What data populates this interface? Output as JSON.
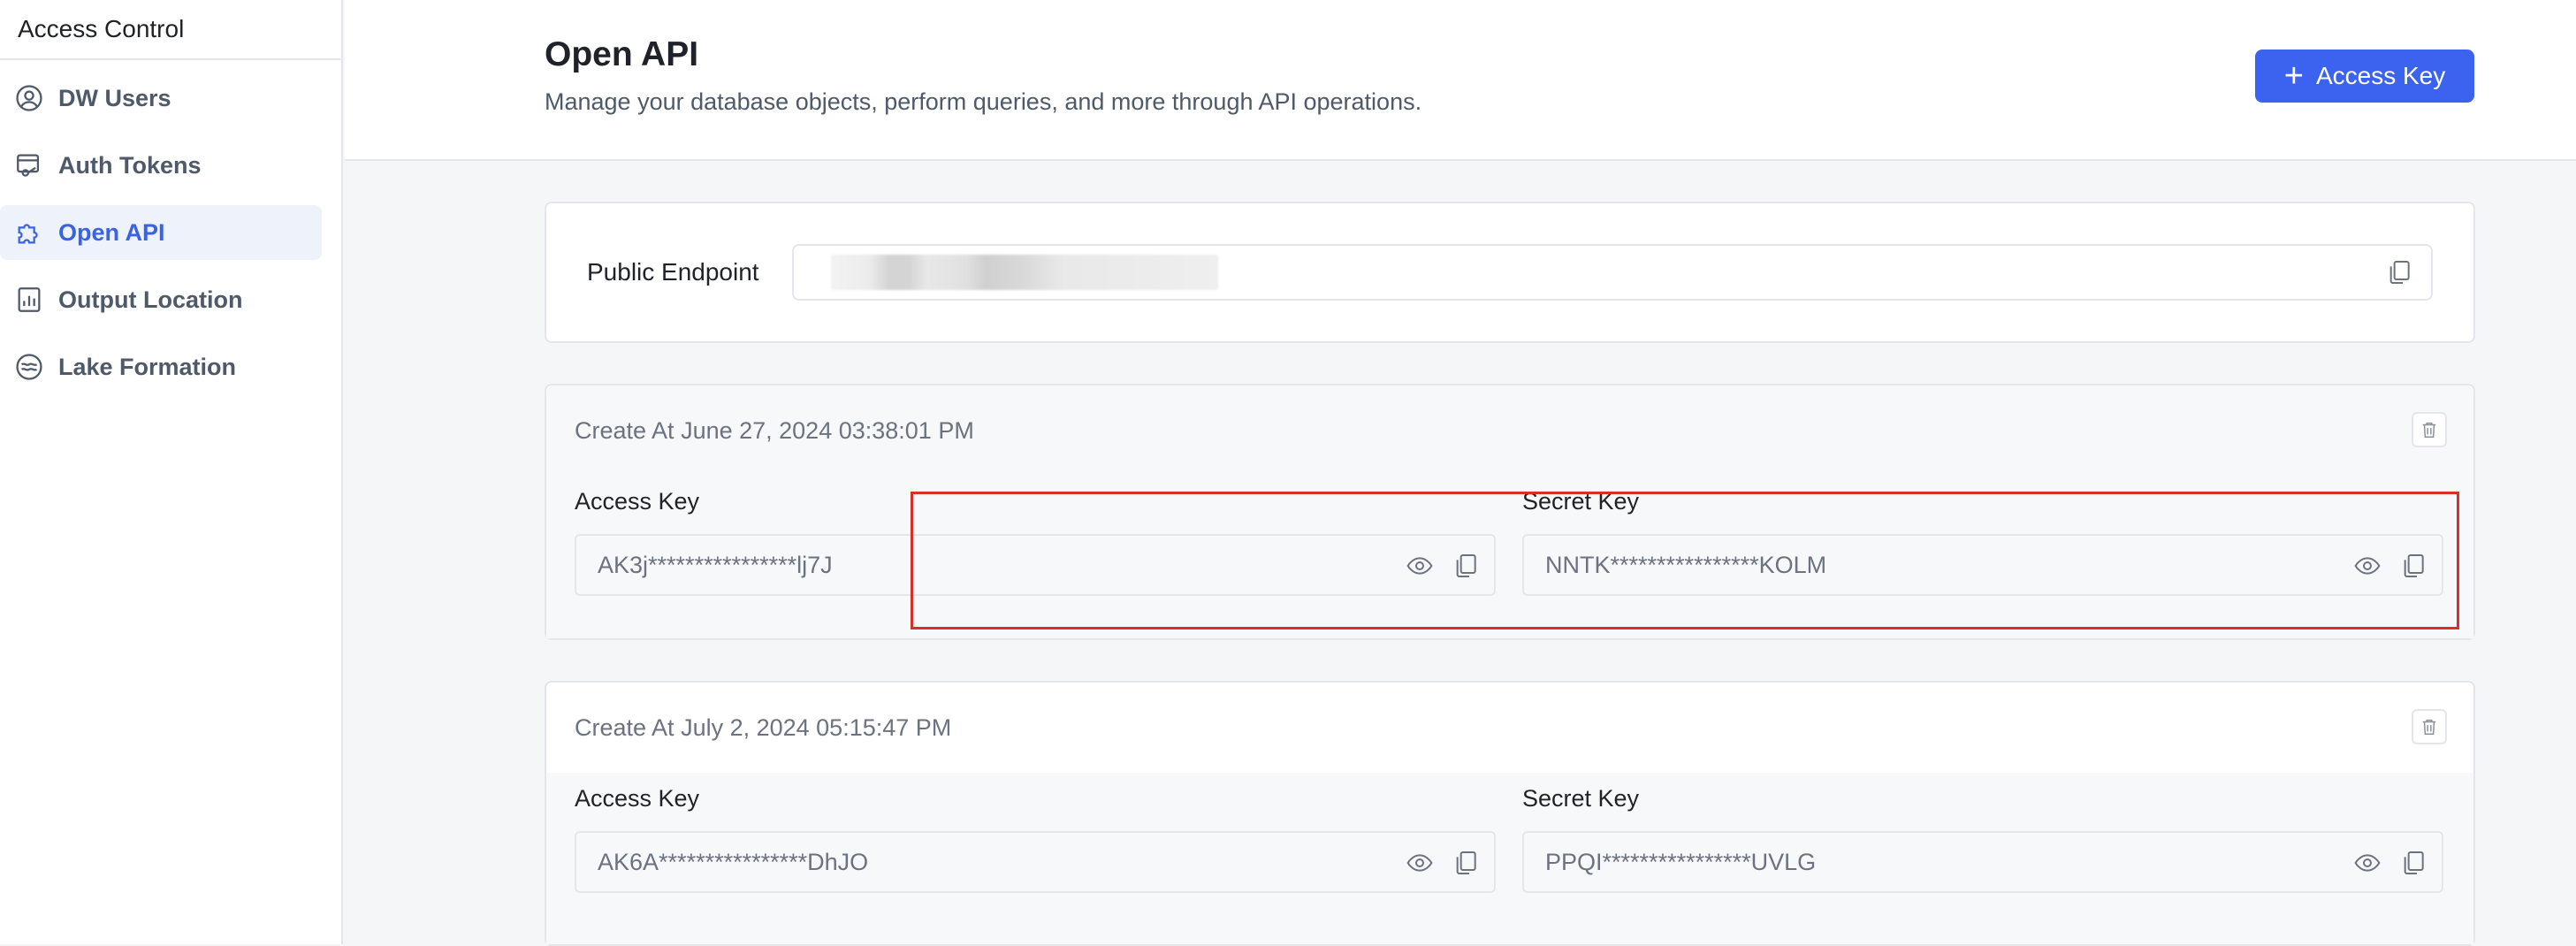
{
  "sidebar": {
    "title": "Access Control",
    "items": [
      {
        "label": "DW Users",
        "icon": "user-circle-icon",
        "active": false
      },
      {
        "label": "Auth Tokens",
        "icon": "token-icon",
        "active": false
      },
      {
        "label": "Open API",
        "icon": "puzzle-icon",
        "active": true
      },
      {
        "label": "Output Location",
        "icon": "chart-file-icon",
        "active": false
      },
      {
        "label": "Lake Formation",
        "icon": "lake-icon",
        "active": false
      }
    ]
  },
  "header": {
    "title": "Open API",
    "subtitle": "Manage your database objects, perform queries, and more through API operations.",
    "add_button_label": "Access Key"
  },
  "endpoint": {
    "label": "Public Endpoint",
    "value_redacted": true
  },
  "keys": [
    {
      "created_at": "Create At June 27, 2024 03:38:01 PM",
      "access_key_label": "Access Key",
      "access_key": "AK3j****************lj7J",
      "secret_key_label": "Secret Key",
      "secret_key": "NNTK****************KOLM",
      "highlighted": true
    },
    {
      "created_at": "Create At July 2, 2024 05:15:47 PM",
      "access_key_label": "Access Key",
      "access_key": "AK6A****************DhJO",
      "secret_key_label": "Secret Key",
      "secret_key": "PPQI****************UVLG",
      "highlighted": false
    }
  ],
  "colors": {
    "accent": "#3b63f0",
    "active_nav_bg": "#eef2fb",
    "active_nav_text": "#3a63e3",
    "highlight": "#d93025"
  }
}
